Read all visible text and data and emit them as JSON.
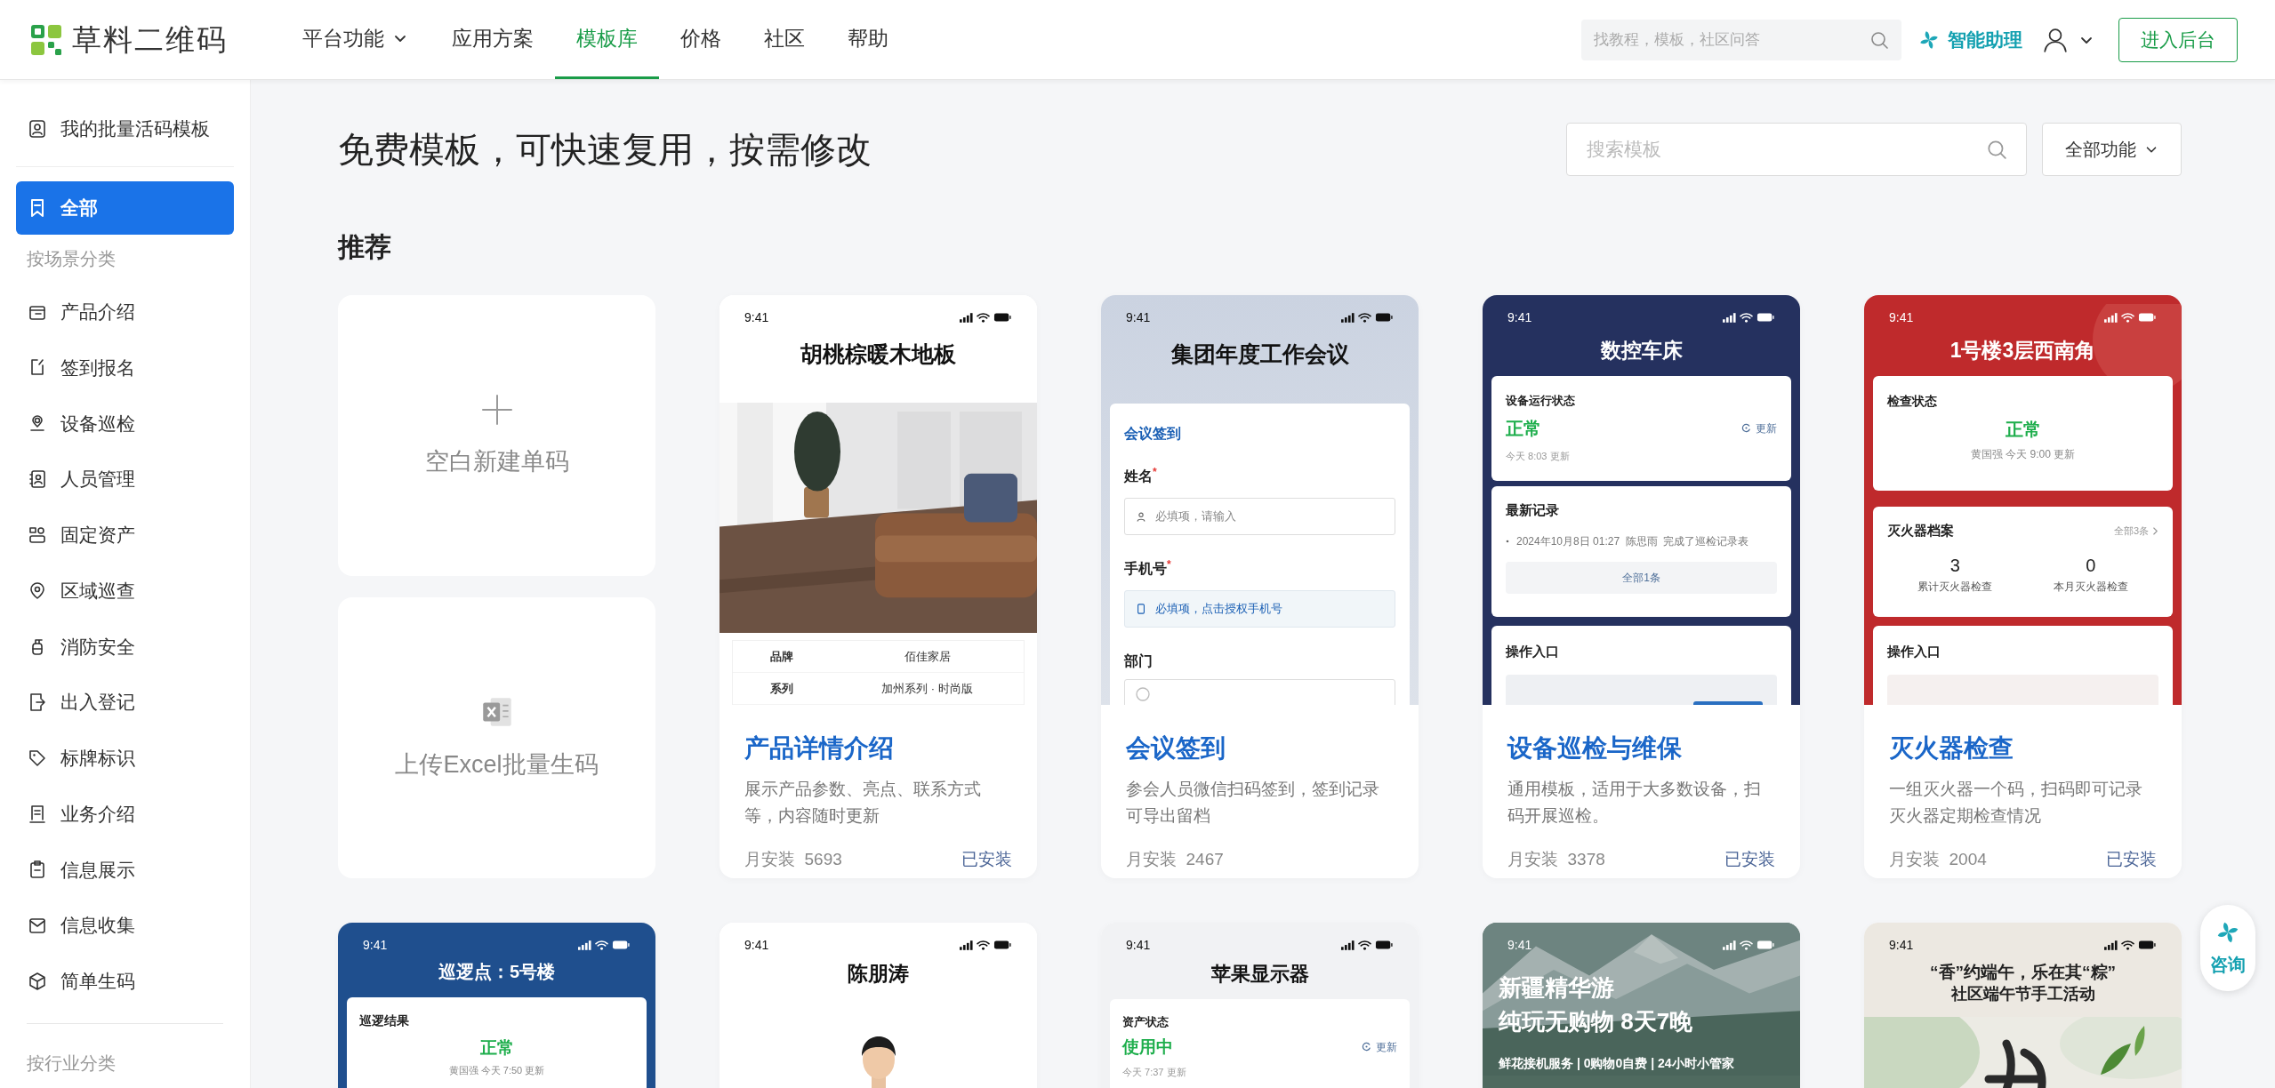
{
  "header": {
    "logo": "草料二维码",
    "nav": [
      {
        "label": "平台功能",
        "has_menu": true,
        "selected": false
      },
      {
        "label": "应用方案",
        "has_menu": false,
        "selected": false
      },
      {
        "label": "模板库",
        "has_menu": false,
        "selected": true
      },
      {
        "label": "价格",
        "has_menu": false,
        "selected": false
      },
      {
        "label": "社区",
        "has_menu": false,
        "selected": false
      },
      {
        "label": "帮助",
        "has_menu": false,
        "selected": false
      }
    ],
    "search": {
      "placeholder": "找教程，模板，社区问答"
    },
    "assistant": "智能助理",
    "enter_button": "进入后台"
  },
  "sidebar": {
    "saved_templates": "我的批量活码模板",
    "items": [
      {
        "kind": "entry",
        "label": "全部",
        "selected": true
      },
      {
        "kind": "heading",
        "label": "按场景分类"
      },
      {
        "kind": "entry",
        "label": "产品介绍",
        "selected": false
      },
      {
        "kind": "entry",
        "label": "签到报名",
        "selected": false
      },
      {
        "kind": "entry",
        "label": "设备巡检",
        "selected": false
      },
      {
        "kind": "entry",
        "label": "人员管理",
        "selected": false
      },
      {
        "kind": "entry",
        "label": "固定资产",
        "selected": false
      },
      {
        "kind": "entry",
        "label": "区域巡查",
        "selected": false
      },
      {
        "kind": "entry",
        "label": "消防安全",
        "selected": false
      },
      {
        "kind": "entry",
        "label": "出入登记",
        "selected": false
      },
      {
        "kind": "entry",
        "label": "标牌标识",
        "selected": false
      },
      {
        "kind": "entry",
        "label": "业务介绍",
        "selected": false
      },
      {
        "kind": "entry",
        "label": "信息展示",
        "selected": false
      },
      {
        "kind": "entry",
        "label": "信息收集",
        "selected": false
      },
      {
        "kind": "entry",
        "label": "简单生码",
        "selected": false
      },
      {
        "kind": "heading",
        "label": "按行业分类"
      }
    ]
  },
  "main": {
    "title": "免费模板，可快速复用，按需修改",
    "search": {
      "placeholder": "搜索模板"
    },
    "filter": "全部功能",
    "section": "推荐",
    "actions": [
      {
        "kind": "blank",
        "label": "空白新建单码"
      },
      {
        "kind": "excel",
        "label": "上传Excel批量生码"
      }
    ],
    "templates": [
      {
        "kind": "product",
        "status_time": "9:41",
        "preview_title": "胡桃棕暖木地板",
        "specs": [
          {
            "label": "品牌",
            "value": "佰佳家居"
          },
          {
            "label": "系列",
            "value": "加州系列 · 时尚版"
          }
        ],
        "title": "产品详情介绍",
        "description": "展示产品参数、亮点、联系方式等，内容随时更新",
        "installs_label": "月安装",
        "installs": "5693",
        "status": "已安装"
      },
      {
        "kind": "form",
        "status_time": "9:41",
        "preview_title": "集团年度工作会议",
        "form_title": "会议签到",
        "fields": [
          {
            "kind": "text",
            "label": "姓名$^{*}$",
            "placeholder": "必填项，请输入"
          },
          {
            "kind": "phone",
            "label": "手机号$^{*}$",
            "placeholder": "必填项，点击授权手机号"
          },
          {
            "kind": "radio",
            "label": "部门"
          }
        ],
        "title": "会议签到",
        "description": "参会人员微信扫码签到，签到记录可导出留档",
        "installs_label": "月安装",
        "installs": "2467"
      },
      {
        "kind": "device",
        "status_time": "9:41",
        "preview_title": "数控车床",
        "status_label": "设备运行状态",
        "status_value": "正常",
        "refresh": "更新",
        "updated": "今天 8:03 更新",
        "records_title": "最新记录",
        "record": "2024年10月8日 01:27  陈思雨  完成了巡检记录表",
        "records_more": "全部1条",
        "actions_title": "操作入口",
        "title": "设备巡检与维保",
        "description": "通用模板，适用于大多数设备，扫码开展巡检。",
        "installs_label": "月安装",
        "installs": "3378",
        "status": "已安装"
      },
      {
        "kind": "fire",
        "status_time": "9:41",
        "preview_title": "1号楼3层西南角",
        "status_label": "检查状态",
        "status_value": "正常",
        "updated": "黄国强 今天 9:00 更新",
        "archive_title": "灭火器档案",
        "archive_more": "全部3条",
        "stats": [
          {
            "value": "3",
            "label": "累计灭火器检查"
          },
          {
            "value": "0",
            "label": "本月灭火器检查"
          }
        ],
        "actions_title": "操作入口",
        "title": "灭火器检查",
        "description": "一组灭火器一个码，扫码即可记录灭火器定期检查情况",
        "installs_label": "月安装",
        "installs": "2004",
        "status": "已安装"
      },
      {
        "kind": "patrol",
        "status_time": "9:41",
        "preview_title": "巡逻点：5号楼",
        "status_label": "巡逻结果",
        "status_value": "正常",
        "updated": "黄国强 今天 7:50 更新"
      },
      {
        "kind": "person",
        "status_time": "9:41",
        "preview_title": "陈朋涛"
      },
      {
        "kind": "asset",
        "status_time": "9:41",
        "preview_title": "苹果显示器",
        "status_label": "资产状态",
        "status_value": "使用中",
        "refresh": "更新",
        "updated": "今天 7:37 更新"
      },
      {
        "kind": "travel",
        "status_time": "9:41",
        "headline": [
          "新疆精华游",
          "纯玩无购物 8天7晚"
        ],
        "tagline": "鲜花接机服务 | 0购物0自费 | 24小时小管家"
      },
      {
        "kind": "festival",
        "status_time": "9:41",
        "preview_title": "“香”约端午，乐在其“粽”",
        "subtitle": "社区端午节手工活动"
      }
    ]
  },
  "consult_button": "咨询"
}
